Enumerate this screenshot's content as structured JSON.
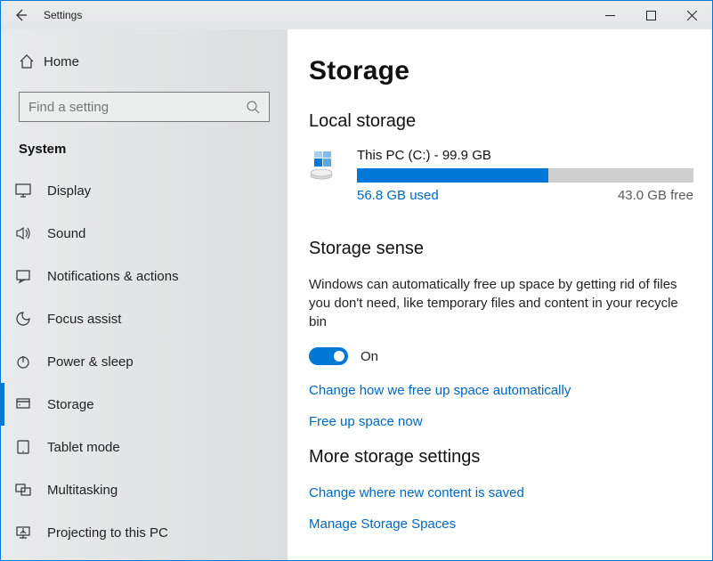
{
  "titlebar": {
    "app": "Settings"
  },
  "sidebar": {
    "home": "Home",
    "search_placeholder": "Find a setting",
    "section": "System",
    "items": [
      {
        "icon": "display",
        "label": "Display"
      },
      {
        "icon": "sound",
        "label": "Sound"
      },
      {
        "icon": "notifications",
        "label": "Notifications & actions"
      },
      {
        "icon": "focus",
        "label": "Focus assist"
      },
      {
        "icon": "power",
        "label": "Power & sleep"
      },
      {
        "icon": "storage",
        "label": "Storage",
        "selected": true
      },
      {
        "icon": "tablet",
        "label": "Tablet mode"
      },
      {
        "icon": "multitask",
        "label": "Multitasking"
      },
      {
        "icon": "project",
        "label": "Projecting to this PC"
      }
    ]
  },
  "page": {
    "title": "Storage",
    "local_storage": {
      "heading": "Local storage",
      "drive": {
        "name": "This PC (C:) - 99.9 GB",
        "total_gb": 99.9,
        "used_gb": 56.8,
        "free_gb": 43.0,
        "used_label": "56.8 GB used",
        "free_label": "43.0 GB free",
        "used_pct": 56.9
      }
    },
    "storage_sense": {
      "heading": "Storage sense",
      "body": "Windows can automatically free up space by getting rid of files you don't need, like temporary files and content in your recycle bin",
      "toggle_on": true,
      "toggle_label": "On",
      "link1": "Change how we free up space automatically",
      "link2": "Free up space now"
    },
    "more": {
      "heading": "More storage settings",
      "link1": "Change where new content is saved",
      "link2": "Manage Storage Spaces"
    }
  },
  "chart_data": {
    "type": "bar",
    "title": "This PC (C:) storage usage",
    "categories": [
      "Used",
      "Free"
    ],
    "values": [
      56.8,
      43.0
    ],
    "total": 99.9,
    "unit": "GB",
    "ylim": [
      0,
      99.9
    ]
  }
}
